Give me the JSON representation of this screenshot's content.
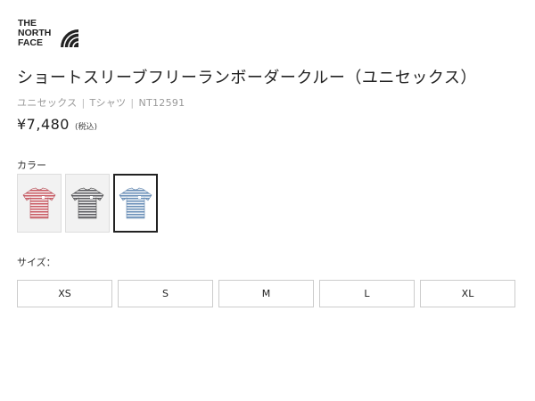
{
  "brand": {
    "logo_text": "THE NORTH FACE",
    "logo_lines": [
      "THE",
      "NORTH",
      "FACE"
    ]
  },
  "product": {
    "title": "ショートスリーブフリーランボーダークルー（ユニセックス）",
    "gender": "ユニセックス",
    "category": "Tシャツ",
    "sku": "NT12591",
    "separator": "|",
    "price": "¥7,480",
    "tax_note": "(税込)"
  },
  "color_section": {
    "label": "カラー",
    "options": [
      {
        "name": "red-stripe",
        "stripe_color": "#c95a63",
        "base_color": "#f3f3f3",
        "selected": false
      },
      {
        "name": "charcoal-stripe",
        "stripe_color": "#5b5b60",
        "base_color": "#f3f3f3",
        "selected": false
      },
      {
        "name": "blue-stripe",
        "stripe_color": "#6a8fb8",
        "base_color": "#ffffff",
        "selected": true
      }
    ]
  },
  "size_section": {
    "label": "サイズ：",
    "options": [
      "XS",
      "S",
      "M",
      "L",
      "XL"
    ]
  }
}
